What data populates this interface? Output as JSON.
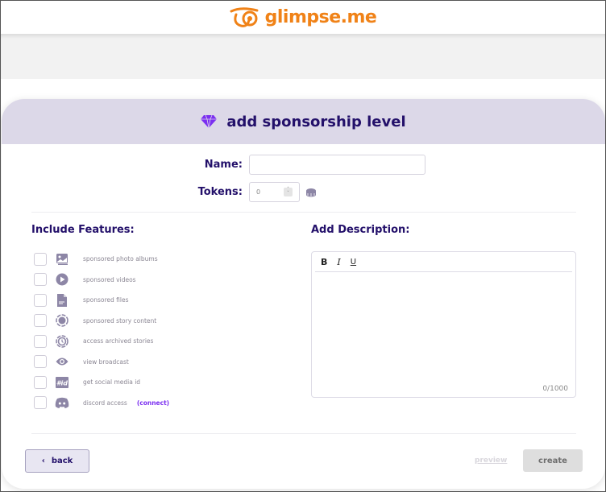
{
  "brand": {
    "name": "glimpse.me",
    "color": "#f08217"
  },
  "dialog": {
    "title": "add sponsorship level",
    "title_icon": "diamond-icon",
    "accent": "#7b2ff0"
  },
  "form": {
    "name_label": "Name:",
    "name_value": "",
    "tokens_label": "Tokens:",
    "tokens_value": "0",
    "tokens_icon": "coin-stack-icon"
  },
  "features": {
    "title": "Include Features:",
    "items": [
      {
        "label": "sponsored photo albums",
        "icon": "photo-album-icon",
        "checked": false
      },
      {
        "label": "sponsored videos",
        "icon": "play-circle-icon",
        "checked": false
      },
      {
        "label": "sponsored files",
        "icon": "file-icon",
        "checked": false
      },
      {
        "label": "sponsored story content",
        "icon": "story-ring-icon",
        "checked": false
      },
      {
        "label": "access archived stories",
        "icon": "archive-clock-icon",
        "checked": false
      },
      {
        "label": "view broadcast",
        "icon": "eye-icon",
        "checked": false
      },
      {
        "label": "get social media id",
        "icon": "social-id-icon",
        "checked": false
      },
      {
        "label": "discord access",
        "icon": "discord-icon",
        "checked": false,
        "link": "(connect)"
      }
    ]
  },
  "description": {
    "title": "Add Description:",
    "toolbar": {
      "bold": "B",
      "italic": "I",
      "underline": "U"
    },
    "value": "",
    "counter": "0/1000"
  },
  "footer": {
    "back_label": "back",
    "preview_label": "preview",
    "create_label": "create"
  }
}
